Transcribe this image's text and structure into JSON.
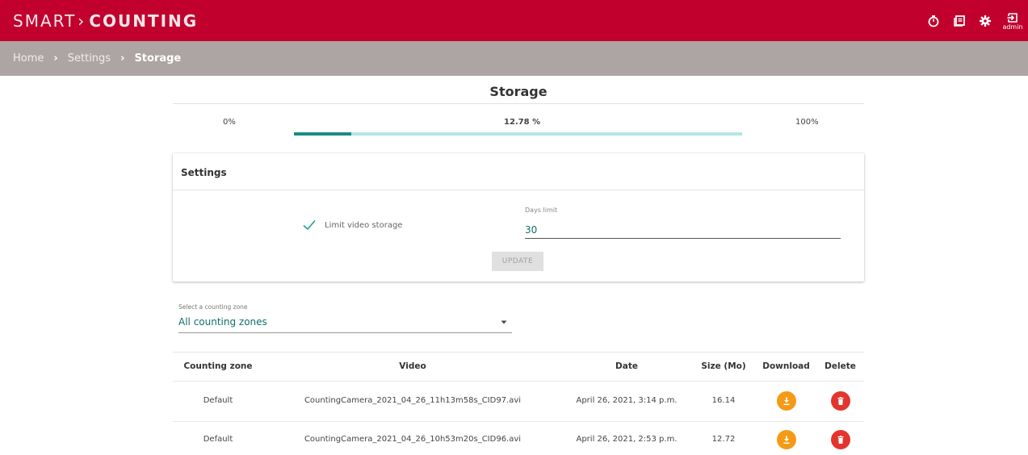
{
  "header": {
    "brand_part1": "SMART",
    "brand_part2": "COUNTING",
    "icons": [
      "timer-icon",
      "document-list-icon",
      "gear-icon",
      "logout-icon"
    ],
    "user_label": "admin",
    "color": "#c1002e"
  },
  "breadcrumb": {
    "items": [
      "Home",
      "Settings",
      "Storage"
    ]
  },
  "page": {
    "title": "Storage"
  },
  "storage_usage": {
    "min_label": "0%",
    "value_label": "12.78 %",
    "max_label": "100%",
    "percent": 12.78,
    "bar_color": "#1a8c87",
    "track_color": "#b2e6e3"
  },
  "settings": {
    "title": "Settings",
    "limit_label": "Limit video storage",
    "limit_checked": true,
    "days_label": "Days limit",
    "days_value": "30",
    "update_label": "UPDATE"
  },
  "zone_select": {
    "label": "Select a counting zone",
    "value": "All counting zones"
  },
  "table": {
    "columns": [
      "Counting zone",
      "Video",
      "Date",
      "Size (Mo)",
      "Download",
      "Delete"
    ],
    "rows": [
      [
        "Default",
        "CountingCamera_2021_04_26_11h13m58s_CID97.avi",
        "April 26, 2021, 3:14 p.m.",
        "16.14"
      ],
      [
        "Default",
        "CountingCamera_2021_04_26_10h53m20s_CID96.avi",
        "April 26, 2021, 2:53 p.m.",
        "12.72"
      ]
    ],
    "download_color": "#f59a17",
    "delete_color": "#e2352f"
  }
}
